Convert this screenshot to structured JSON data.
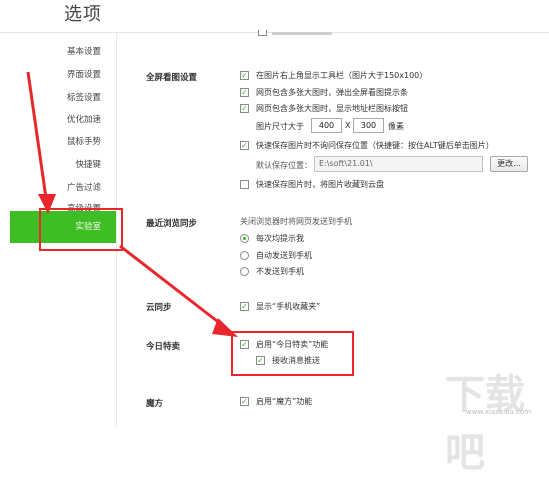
{
  "window": {
    "title": "选项"
  },
  "sidebar": {
    "items": [
      {
        "label": "基本设置"
      },
      {
        "label": "界面设置"
      },
      {
        "label": "标签设置"
      },
      {
        "label": "优化加速"
      },
      {
        "label": "鼠标手势"
      },
      {
        "label": "快捷键"
      },
      {
        "label": "广告过滤"
      },
      {
        "label": "高级设置"
      },
      {
        "label": "实验室",
        "active": true
      }
    ]
  },
  "fullscreen": {
    "heading": "全屏看图设置",
    "opt_toolbar": {
      "label": "在图片右上角显示工具栏（图片大于150x100）",
      "checked": true
    },
    "opt_tip": {
      "label": "网页包含多张大图时，弹出全屏看图提示条",
      "checked": true
    },
    "opt_addr": {
      "label": "网页包含多张大图时，显示地址栏图标按钮",
      "checked": true
    },
    "size_prefix": "图片尺寸大于",
    "size_w": "400",
    "size_sep": "X",
    "size_h": "300",
    "size_unit": "像素",
    "opt_quicksave": {
      "label": "快速保存图片时不询问保存位置（快捷键：按住ALT键后单击图片）",
      "checked": true
    },
    "save_label": "默认保存位置：",
    "save_path": "E:\\soft\\21.01\\",
    "change_button": "更改...",
    "opt_cloud": {
      "label": "快速保存图片时，将图片收藏到云盘",
      "checked": false
    }
  },
  "sync_browse": {
    "heading": "最近浏览同步",
    "desc": "关闭浏览器时将网页发送到手机",
    "options": [
      {
        "label": "每次均提示我",
        "selected": true
      },
      {
        "label": "自动发送到手机",
        "selected": false
      },
      {
        "label": "不发送到手机",
        "selected": false
      }
    ]
  },
  "cloud_sync": {
    "heading": "云同步",
    "option": {
      "label": "显示“手机收藏夹”",
      "checked": true
    }
  },
  "today_special": {
    "heading": "今日特卖",
    "enable": {
      "label": "启用“今日特卖”功能",
      "checked": true
    },
    "push": {
      "label": "接收消息推送",
      "checked": true
    }
  },
  "magic": {
    "heading": "魔方",
    "enable": {
      "label": "启用“魔方”功能",
      "checked": true
    }
  },
  "watermark": {
    "text": "下载吧",
    "url": "www.xiazaiba.com"
  },
  "colors": {
    "accent": "#3fbd25",
    "annotation": "#e8262c"
  }
}
